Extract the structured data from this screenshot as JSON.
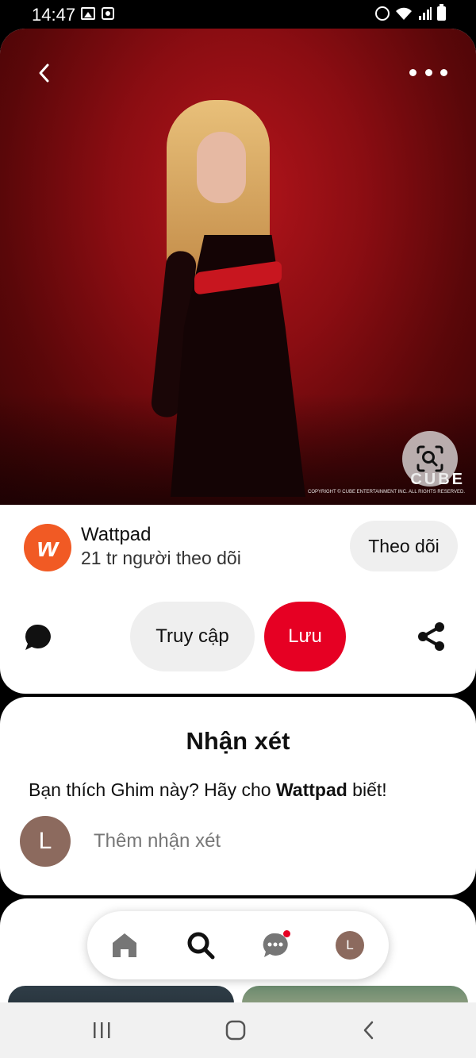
{
  "status_bar": {
    "time": "14:47",
    "icons": [
      "gallery-icon",
      "screen-record-icon",
      "alarm-icon",
      "wifi-icon",
      "signal-icon",
      "battery-icon"
    ]
  },
  "pin": {
    "image": {
      "description": "photo of woman in black and red dress on red background",
      "watermark_logo": "CUBE",
      "watermark_copyright": "COPYRIGHT © CUBE ENTERTAINMENT INC. ALL RIGHTS RESERVED."
    },
    "header_icons": [
      "back-icon",
      "more-options-icon"
    ],
    "visual_search_icon": "lens-icon"
  },
  "creator": {
    "avatar_letter": "w",
    "avatar_color": "#f15a24",
    "name": "Wattpad",
    "followers": "21 tr người theo dõi",
    "follow_label": "Theo dõi"
  },
  "actions": {
    "visit_label": "Truy cập",
    "save_label": "Lưu",
    "save_color": "#e60023"
  },
  "comments": {
    "title": "Nhận xét",
    "prompt_prefix": "Bạn thích Ghim này? Hãy cho ",
    "prompt_brand": "Wattpad",
    "prompt_suffix": " biết!",
    "user_initial": "L",
    "input_placeholder": "Thêm nhận xét"
  },
  "bottom_nav": {
    "items": [
      "home-icon",
      "search-icon",
      "messages-icon",
      "profile-avatar"
    ],
    "profile_initial": "L",
    "has_notification": true
  },
  "system_nav": {
    "buttons": [
      "recents",
      "home",
      "back"
    ]
  }
}
